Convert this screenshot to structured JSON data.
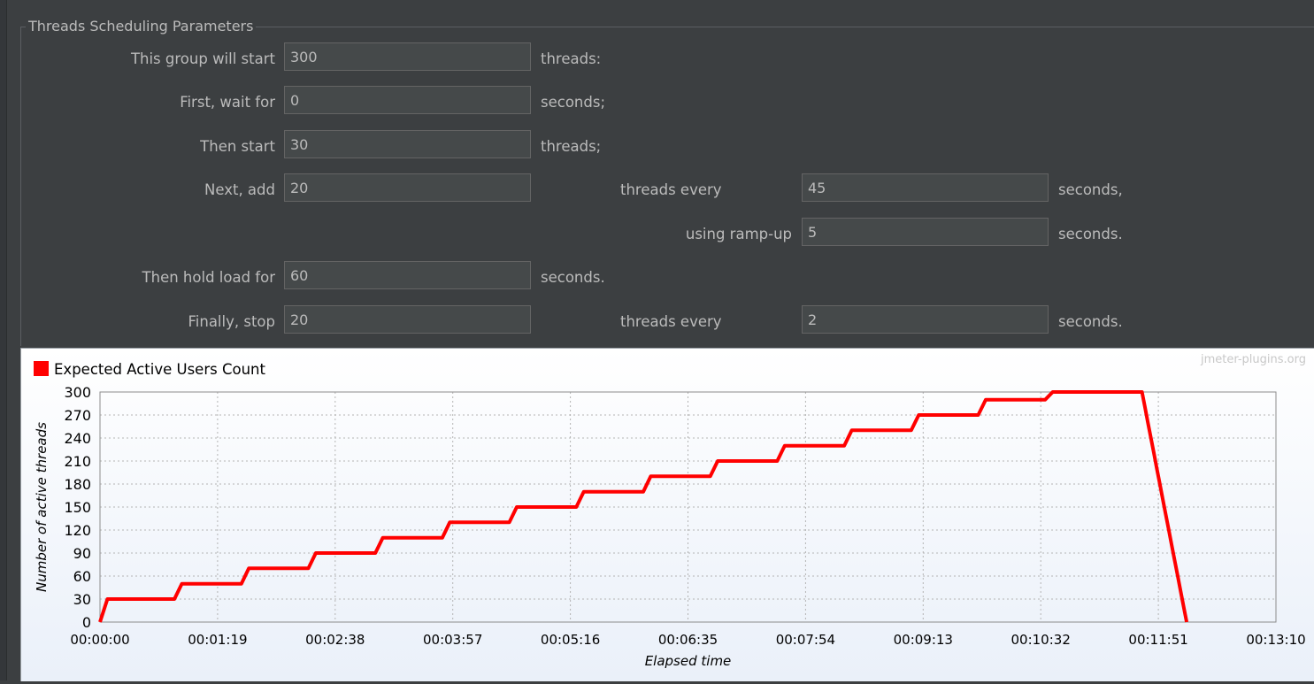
{
  "params": {
    "section_title": "Threads Scheduling Parameters",
    "rows": {
      "start_label": "This group will start",
      "start_value": "300",
      "start_unit": "threads:",
      "wait_label": "First, wait for",
      "wait_value": "0",
      "wait_unit": "seconds;",
      "then_start_label": "Then start",
      "then_start_value": "30",
      "then_start_unit": "threads;",
      "add_label": "Next, add",
      "add_value": "20",
      "add_every_label": "threads every",
      "add_every_value": "45",
      "add_every_unit": "seconds,",
      "rampup_label": "using ramp-up",
      "rampup_value": "5",
      "rampup_unit": "seconds.",
      "hold_label": "Then hold load for",
      "hold_value": "60",
      "hold_unit": "seconds.",
      "stop_label": "Finally, stop",
      "stop_value": "20",
      "stop_every_label": "threads every",
      "stop_every_value": "2",
      "stop_every_unit": "seconds."
    }
  },
  "chart_data": {
    "type": "line",
    "title": "",
    "watermark": "jmeter-plugins.org",
    "xlabel": "Elapsed time",
    "ylabel": "Number of active threads",
    "ylim": [
      0,
      300
    ],
    "xlim": [
      "00:00:00",
      "00:13:10"
    ],
    "y_ticks": [
      0,
      30,
      60,
      90,
      120,
      150,
      180,
      210,
      240,
      270,
      300
    ],
    "x_ticks": [
      "00:00:00",
      "00:01:19",
      "00:02:38",
      "00:03:57",
      "00:05:16",
      "00:06:35",
      "00:07:54",
      "00:09:13",
      "00:10:32",
      "00:11:51",
      "00:13:10"
    ],
    "grid": true,
    "legend_position": "top-left",
    "series": [
      {
        "name": "Expected Active Users Count",
        "color": "#ff0000",
        "points": [
          [
            "00:00:00",
            0
          ],
          [
            "00:00:05",
            30
          ],
          [
            "00:00:50",
            30
          ],
          [
            "00:00:55",
            50
          ],
          [
            "00:01:35",
            50
          ],
          [
            "00:01:40",
            70
          ],
          [
            "00:02:20",
            70
          ],
          [
            "00:02:25",
            90
          ],
          [
            "00:03:05",
            90
          ],
          [
            "00:03:10",
            110
          ],
          [
            "00:03:50",
            110
          ],
          [
            "00:03:55",
            130
          ],
          [
            "00:04:35",
            130
          ],
          [
            "00:04:40",
            150
          ],
          [
            "00:05:20",
            150
          ],
          [
            "00:05:25",
            170
          ],
          [
            "00:06:05",
            170
          ],
          [
            "00:06:10",
            190
          ],
          [
            "00:06:50",
            190
          ],
          [
            "00:06:55",
            210
          ],
          [
            "00:07:35",
            210
          ],
          [
            "00:07:40",
            230
          ],
          [
            "00:08:20",
            230
          ],
          [
            "00:08:25",
            250
          ],
          [
            "00:09:05",
            250
          ],
          [
            "00:09:10",
            270
          ],
          [
            "00:09:50",
            270
          ],
          [
            "00:09:55",
            290
          ],
          [
            "00:10:35",
            290
          ],
          [
            "00:10:40",
            300
          ],
          [
            "00:11:40",
            300
          ],
          [
            "00:11:42",
            280
          ],
          [
            "00:11:44",
            260
          ],
          [
            "00:11:46",
            240
          ],
          [
            "00:11:48",
            220
          ],
          [
            "00:11:50",
            200
          ],
          [
            "00:11:52",
            180
          ],
          [
            "00:11:54",
            160
          ],
          [
            "00:11:56",
            140
          ],
          [
            "00:11:58",
            120
          ],
          [
            "00:12:00",
            100
          ],
          [
            "00:12:02",
            80
          ],
          [
            "00:12:04",
            60
          ],
          [
            "00:12:06",
            40
          ],
          [
            "00:12:08",
            20
          ],
          [
            "00:12:10",
            0
          ]
        ]
      }
    ]
  }
}
